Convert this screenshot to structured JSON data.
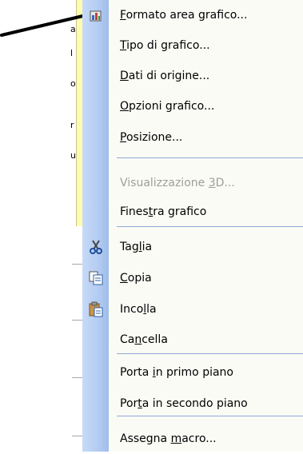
{
  "menu": {
    "items": [
      {
        "pre": "",
        "u": "F",
        "post": "ormato area grafico...",
        "disabled": false,
        "icon": "format-icon"
      },
      {
        "pre": "",
        "u": "T",
        "post": "ipo di grafico...",
        "disabled": false,
        "icon": ""
      },
      {
        "pre": "",
        "u": "D",
        "post": "ati di origine...",
        "disabled": false,
        "icon": ""
      },
      {
        "pre": "",
        "u": "O",
        "post": "pzioni grafico...",
        "disabled": false,
        "icon": ""
      },
      {
        "pre": "",
        "u": "P",
        "post": "osizione...",
        "disabled": false,
        "icon": ""
      },
      {
        "pre": "Visualizzazione ",
        "u": "3",
        "post": "D...",
        "disabled": true,
        "icon": ""
      },
      {
        "pre": "Fines",
        "u": "t",
        "post": "ra grafico",
        "disabled": false,
        "icon": ""
      },
      {
        "pre": "Tag",
        "u": "l",
        "post": "ia",
        "disabled": false,
        "icon": "scissors-icon"
      },
      {
        "pre": "",
        "u": "C",
        "post": "opia",
        "disabled": false,
        "icon": "copy-icon"
      },
      {
        "pre": "Inco",
        "u": "l",
        "post": "la",
        "disabled": false,
        "icon": "paste-icon"
      },
      {
        "pre": "Ca",
        "u": "n",
        "post": "cella",
        "disabled": false,
        "icon": ""
      },
      {
        "pre": "Porta ",
        "u": "i",
        "post": "n primo piano",
        "disabled": false,
        "icon": ""
      },
      {
        "pre": "Por",
        "u": "t",
        "post": "a in secondo piano",
        "disabled": false,
        "icon": ""
      },
      {
        "pre": "Assegna ",
        "u": "m",
        "post": "acro...",
        "disabled": false,
        "icon": ""
      }
    ]
  },
  "background_slivers": [
    "a",
    "l",
    "o",
    "r",
    "u"
  ],
  "colors": {
    "menu_bg": "#fbfbf6",
    "icon_column": "#b3ccf2",
    "separator": "#8fa9d6",
    "disabled_text": "#9d9d9d",
    "panel_yellow": "#fffcb0"
  }
}
